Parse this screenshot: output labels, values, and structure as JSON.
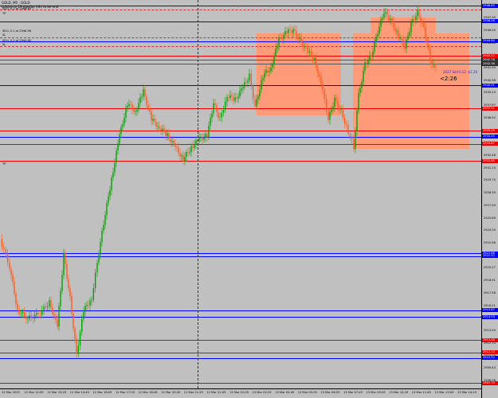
{
  "symbol_info": {
    "line1": "GOLD, M5 : GOLD",
    "line2": "Lotsize to 19 pips/bp (dk) to be end",
    "line3": "SELL 0.1 at 2948.65",
    "tp1": "TP",
    "sl1": "SL",
    "line_sell2": "SELL 0.1 at 2946.96",
    "tp2": "TP",
    "sl2": "SL",
    "sell3": "SELL 0.1 at 2944.80",
    "sl3": "SL",
    "tp_low": "TP"
  },
  "trade_info": "2027 Sell 0.12 -$1.20",
  "timer": "<2:26",
  "colors": {
    "background": "#c0c0c0",
    "bull_candle": "#00a000",
    "bear_candle": "#ff5a1e",
    "zone": "#ff9b78",
    "blue_line": "#0000ff",
    "red_line": "#ee0000"
  },
  "price_scale": {
    "ticks": [
      "2948.74",
      "2947.39",
      "2946.00",
      "2944.64",
      "2943.29",
      "2941.94",
      "2940.58",
      "2939.23",
      "2937.87",
      "2936.52",
      "2935.16",
      "2933.81",
      "2932.46",
      "2931.10",
      "2929.75",
      "2928.39",
      "2927.04",
      "2925.69",
      "2924.33",
      "2922.98",
      "2921.62",
      "2920.27",
      "2918.91",
      "2917.56",
      "2916.21",
      "2914.85",
      "2913.50",
      "2912.14",
      "2910.79",
      "2909.43",
      "2908.08"
    ],
    "labels": [
      {
        "text": "2948.65",
        "color": "#0000ff"
      },
      {
        "text": "2946.96",
        "color": "#0000ff"
      },
      {
        "text": "2944.80",
        "color": "#0000ff"
      },
      {
        "text": "2943.22",
        "color": "#ee0000"
      },
      {
        "text": "2942.78",
        "color": "#333333"
      },
      {
        "text": "2942.36",
        "color": "#333333"
      },
      {
        "text": "2940.01",
        "color": "#0000ff"
      },
      {
        "text": "2937.51",
        "color": "#ee0000"
      },
      {
        "text": "2935.09",
        "color": "#ee0000"
      },
      {
        "text": "2934.45",
        "color": "#0000ff"
      },
      {
        "text": "2933.67",
        "color": "#ee0000"
      },
      {
        "text": "2931.85",
        "color": "#ee0000"
      },
      {
        "text": "2921.86",
        "color": "#0000ff"
      },
      {
        "text": "2921.52",
        "color": "#0000ff"
      },
      {
        "text": "2915.67",
        "color": "#0000ff"
      },
      {
        "text": "2914.93",
        "color": "#0000ff"
      },
      {
        "text": "2912.46",
        "color": "#ee0000"
      },
      {
        "text": "2911.10",
        "color": "#ee0000"
      },
      {
        "text": "2910.52",
        "color": "#0000ff"
      },
      {
        "text": "2907.79",
        "color": "#ee0000"
      }
    ]
  },
  "time_scale": [
    "12 Mar 2025",
    "12 Mar 12:09",
    "12 Mar 13:29",
    "12 Mar 14:49",
    "12 Mar 16:09",
    "12 Mar 17:29",
    "12 Mar 18:49",
    "12 Mar 20:09",
    "12 Mar 21:29",
    "12 Mar 22:49",
    "13 Mar 01:09",
    "13 Mar 02:29",
    "13 Mar 03:49",
    "13 Mar 05:09",
    "13 Mar 06:29",
    "13 Mar 07:49",
    "13 Mar 09:09",
    "13 Mar 10:29",
    "13 Mar 11:49",
    "13 Mar 13:09",
    "13 Mar 14:29"
  ]
}
